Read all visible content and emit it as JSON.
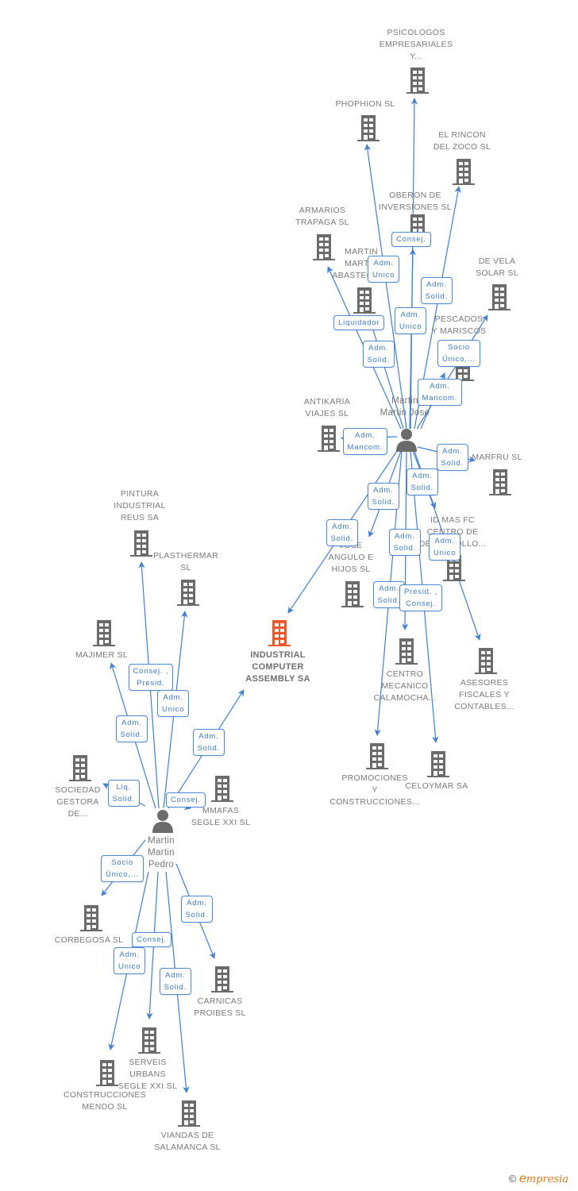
{
  "colors": {
    "edge": "#3f7fd6",
    "company_icon": "#6b6b6b",
    "main_company_icon": "#f2572b",
    "person_icon": "#6b6b6b",
    "label_text": "#7a7a7a",
    "badge_text": "#3a7bd0",
    "badge_border": "#4a8ad6"
  },
  "main_company": {
    "id": "icas",
    "label": "INDUSTRIAL\nCOMPUTER\nASSEMBLY SA"
  },
  "persons": [
    {
      "id": "mmj",
      "label": "Martin\nMartin Jose"
    },
    {
      "id": "mmp",
      "label": "Martin\nMartin\nPedro"
    }
  ],
  "companies": [
    {
      "id": "psico",
      "label": "PSICOLOGOS\nEMPRESARIALES\nY..."
    },
    {
      "id": "phophion",
      "label": "PHOPHION  SL"
    },
    {
      "id": "rincon",
      "label": "EL RINCON\nDEL ZOCO SL"
    },
    {
      "id": "oberon",
      "label": "OBERON DE\nINVERSIONES SL"
    },
    {
      "id": "armarios",
      "label": "ARMARIOS\nTRAPAGA SL"
    },
    {
      "id": "martinabast",
      "label": "MARTIN\nMARTIN\nABASTECIM..."
    },
    {
      "id": "devela",
      "label": "DE VELA\nSOLAR SL"
    },
    {
      "id": "pescados",
      "label": "PESCADOS\nY MARISCOS\nHE... SL"
    },
    {
      "id": "antikaria",
      "label": "ANTIKARIA\nVIAJES  SL"
    },
    {
      "id": "marfru",
      "label": "MARFRU SL"
    },
    {
      "id": "idmas",
      "label": "ID MAS FC\nCENTRO DE\nDESARROLLO..."
    },
    {
      "id": "joseangulo",
      "label": "JOSE\nANGULO E\nHIJOS  SL"
    },
    {
      "id": "centromec",
      "label": "CENTRO\nMECANICO\nCALAMOCHA..."
    },
    {
      "id": "asesores",
      "label": "ASESORES\nFISCALES Y\nCONTABLES..."
    },
    {
      "id": "promociones",
      "label": "PROMOCIONES\nY\nCONSTRUCCIONES..."
    },
    {
      "id": "celoymar",
      "label": "CELOYMAR SA"
    },
    {
      "id": "pintura",
      "label": "PINTURA\nINDUSTRIAL\nREUS SA"
    },
    {
      "id": "plasthermar",
      "label": "PLASTHERMAR\nSL"
    },
    {
      "id": "majimer",
      "label": "MAJIMER SL"
    },
    {
      "id": "sociedad",
      "label": "SOCIEDAD\nGESTORA\nDE..."
    },
    {
      "id": "mmafas",
      "label": "MMAFAS\nSEGLE XXI SL"
    },
    {
      "id": "corbegosa",
      "label": "CORBEGOSA SL"
    },
    {
      "id": "carnicas",
      "label": "CARNICAS\nPROIBES  SL"
    },
    {
      "id": "serveis",
      "label": "SERVEIS\nURBANS\nSEGLE XXI SL"
    },
    {
      "id": "construcciones",
      "label": "CONSTRUCCIONES\nMENDO SL"
    },
    {
      "id": "viandas",
      "label": "VIANDAS DE\nSALAMANCA SL"
    }
  ],
  "relations": [
    {
      "from": "mmj",
      "to": "psico",
      "role": "Consej."
    },
    {
      "from": "mmj",
      "to": "phophion",
      "role": "Adm.\nUnico"
    },
    {
      "from": "mmj",
      "to": "rincon",
      "role": "Adm.\nSolid."
    },
    {
      "from": "mmj",
      "to": "oberon",
      "role": "Adm.\nUnico"
    },
    {
      "from": "mmj",
      "to": "armarios",
      "role": "Liquidador"
    },
    {
      "from": "mmj",
      "to": "martinabast",
      "role": "Adm.\nSolid."
    },
    {
      "from": "mmj",
      "to": "devela",
      "role": "Socio\nÚnico,..."
    },
    {
      "from": "mmj",
      "to": "pescados",
      "role": "Adm.\nMancom."
    },
    {
      "from": "mmj",
      "to": "antikaria",
      "role": "Adm.\nMancom."
    },
    {
      "from": "mmj",
      "to": "marfru",
      "role": "Adm.\nSolid."
    },
    {
      "from": "mmj",
      "to": "idmas",
      "role": "Adm.\nSolid."
    },
    {
      "from": "mmj",
      "to": "joseangulo",
      "role": "Adm.\nSolid."
    },
    {
      "from": "mmj",
      "to": "icas",
      "role": "Adm.\nSolid."
    },
    {
      "from": "mmj",
      "to": "centromec",
      "role": "Adm.\nSolid."
    },
    {
      "from": "mmj",
      "to": "asesores",
      "role": "Adm.\nUnico"
    },
    {
      "from": "mmj",
      "to": "promociones",
      "role": "Adm.\nSolid."
    },
    {
      "from": "mmj",
      "to": "celoymar",
      "role": "Presid. ,\nConsej."
    },
    {
      "from": "mmp",
      "to": "pintura",
      "role": "Consej. ,\nPresid."
    },
    {
      "from": "mmp",
      "to": "plasthermar",
      "role": "Adm.\nUnico"
    },
    {
      "from": "mmp",
      "to": "majimer",
      "role": "Adm.\nSolid."
    },
    {
      "from": "mmp",
      "to": "icas",
      "role": "Adm.\nSolid."
    },
    {
      "from": "mmp",
      "to": "sociedad",
      "role": "Liq.\nSolid."
    },
    {
      "from": "mmp",
      "to": "mmafas",
      "role": "Consej."
    },
    {
      "from": "mmp",
      "to": "corbegosa",
      "role": "Socio\nÚnico,..."
    },
    {
      "from": "mmp",
      "to": "carnicas",
      "role": "Adm.\nSolid."
    },
    {
      "from": "mmp",
      "to": "serveis",
      "role": "Consej."
    },
    {
      "from": "mmp",
      "to": "construcciones",
      "role": "Adm.\nUnico"
    },
    {
      "from": "mmp",
      "to": "viandas",
      "role": "Adm.\nSolid."
    }
  ],
  "footer": {
    "copyright": "©",
    "brand_initial": "e",
    "brand_rest": "mpresia"
  }
}
